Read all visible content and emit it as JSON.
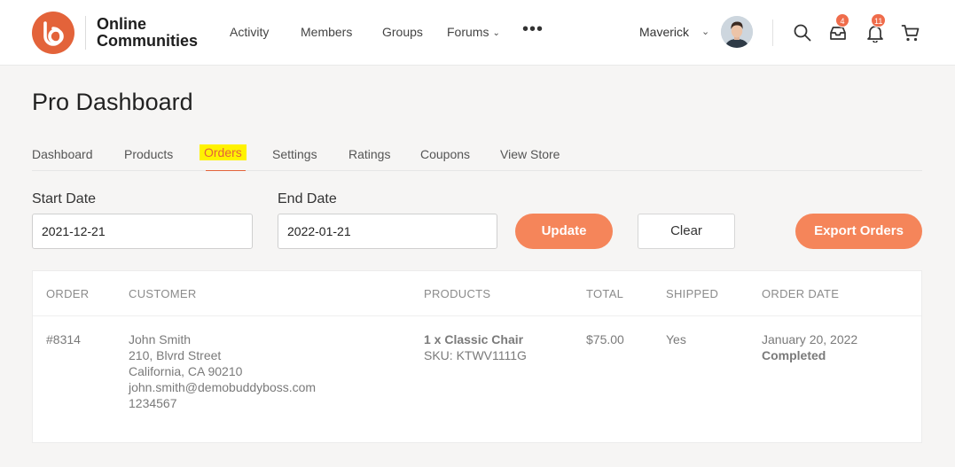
{
  "header": {
    "logo_line1": "Online",
    "logo_line2": "Communities",
    "nav": [
      {
        "label": "Activity"
      },
      {
        "label": "Members"
      },
      {
        "label": "Groups"
      },
      {
        "label": "Forums"
      }
    ],
    "more_label": "•••",
    "user_name": "Maverick",
    "messages_badge": "4",
    "notifications_badge": "11"
  },
  "page": {
    "title": "Pro Dashboard",
    "tabs": [
      {
        "label": "Dashboard"
      },
      {
        "label": "Products"
      },
      {
        "label": "Orders"
      },
      {
        "label": "Settings"
      },
      {
        "label": "Ratings"
      },
      {
        "label": "Coupons"
      },
      {
        "label": "View Store"
      }
    ]
  },
  "filters": {
    "start_label": "Start Date",
    "start_value": "2021-12-21",
    "end_label": "End Date",
    "end_value": "2022-01-21",
    "update_label": "Update",
    "clear_label": "Clear",
    "export_label": "Export Orders"
  },
  "table": {
    "columns": [
      "Order",
      "Customer",
      "Products",
      "Total",
      "Shipped",
      "Order Date"
    ],
    "rows": [
      {
        "order": "#8314",
        "customer_name": "John Smith",
        "customer_street": "210, Blvrd Street",
        "customer_city": "California, CA 90210",
        "customer_email": "john.smith@demobuddyboss.com",
        "customer_phone": "1234567",
        "product": "1 x Classic Chair",
        "sku": "SKU: KTWV1111G",
        "total": "$75.00",
        "shipped": "Yes",
        "date": "January 20, 2022",
        "status": "Completed"
      }
    ]
  },
  "colors": {
    "accent": "#e3633a",
    "button": "#f5855a",
    "highlight": "#fff200"
  }
}
